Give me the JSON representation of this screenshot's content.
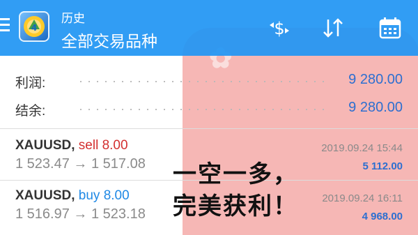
{
  "appbar": {
    "subtitle": "历史",
    "title": "全部交易品种",
    "icons": [
      "menu-icon",
      "metatrader-logo",
      "dollar-swap-icon",
      "sort-icon",
      "calendar-icon"
    ]
  },
  "summary": {
    "profit_label": "利润:",
    "profit_value": "9 280.00",
    "balance_label": "结余:",
    "balance_value": "9 280.00"
  },
  "deals": [
    {
      "symbol": "XAUUSD,",
      "action": "sell 8.00",
      "prices": "1 523.47 → 1 517.08",
      "time": "2019.09.24 15:44",
      "profit": "5 112.00"
    },
    {
      "symbol": "XAUUSD,",
      "action": "buy 8.00",
      "prices": "1 516.97 → 1 523.18",
      "time": "2019.09.24 16:11",
      "profit": "4 968.00"
    }
  ],
  "overlay": {
    "line1": "一空一多，",
    "line2": "完美获利！"
  },
  "colors": {
    "appbar": "#2196f3",
    "value_blue": "#2d6fd0",
    "sell_red": "#d32f2f",
    "buy_blue": "#1e88e5",
    "stamp_red": "#f08a87"
  }
}
